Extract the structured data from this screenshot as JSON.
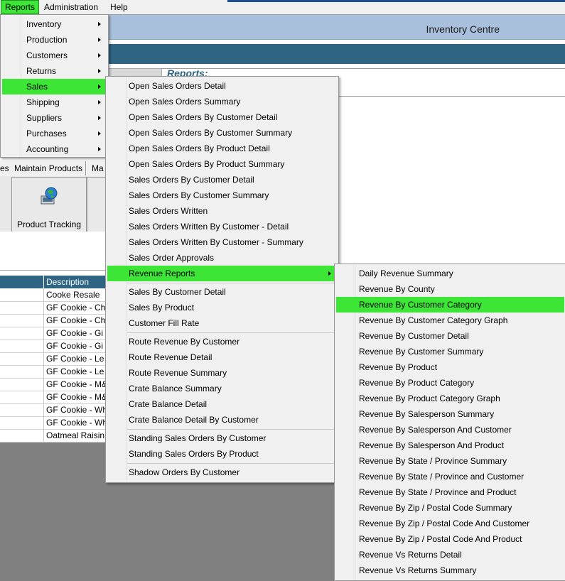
{
  "menubar": {
    "reports": "Reports",
    "administration": "Administration",
    "help": "Help"
  },
  "app": {
    "title": "Inventory Centre",
    "reports_heading": "Reports:",
    "tabs": [
      {
        "label": "es"
      },
      {
        "label": "Maintain Products"
      },
      {
        "label": "Ma"
      }
    ],
    "toolbar_button": {
      "label": "Product Tracking",
      "icon": "globe-computer-icon"
    }
  },
  "grid": {
    "header": "Description",
    "rows": [
      "Cooke Resale",
      "GF Cookie - Ch",
      "GF Cookie - Ch",
      "GF Cookie - Gi",
      "GF Cookie - Gi",
      "GF Cookie - Le",
      "GF Cookie - Le",
      "GF Cookie - M&",
      "GF Cookie - M&",
      "GF Cookie - Wh",
      "GF Cookie - Wh",
      "Oatmeal Raisin"
    ]
  },
  "reports_menu": {
    "items": [
      "Inventory",
      "Production",
      "Customers",
      "Returns",
      "Sales",
      "Shipping",
      "Suppliers",
      "Purchases",
      "Accounting"
    ],
    "highlighted": "Sales"
  },
  "sales_menu": {
    "items": [
      "Open Sales Orders Detail",
      "Open Sales Orders Summary",
      "Open Sales Orders By Customer Detail",
      "Open Sales Orders By Customer Summary",
      "Open Sales Orders By Product Detail",
      "Open Sales Orders By Product Summary",
      "Sales Orders By Customer Detail",
      "Sales Orders By Customer Summary",
      "Sales Orders Written",
      "Sales Orders Written By Customer - Detail",
      "Sales Orders Written By Customer - Summary",
      "Sales Order Approvals",
      "Revenue Reports",
      "Sales By Customer Detail",
      "Sales By Product",
      "Customer Fill Rate",
      "Route Revenue By Customer",
      "Route Revenue Detail",
      "Route Revenue Summary",
      "Crate Balance Summary",
      "Crate Balance Detail",
      "Crate Balance Detail By Customer",
      "Standing Sales Orders By Customer",
      "Standing Sales Orders By Product",
      "Shadow Orders By Customer"
    ],
    "highlighted": "Revenue Reports"
  },
  "revenue_menu": {
    "items": [
      "Daily Revenue Summary",
      "Revenue By County",
      "Revenue By Customer Category",
      "Revenue By Customer Category Graph",
      "Revenue By Customer Detail",
      "Revenue By Customer Summary",
      "Revenue By Product",
      "Revenue By Product Category",
      "Revenue By Product Category Graph",
      "Revenue By Salesperson Summary",
      "Revenue By Salesperson And Customer",
      "Revenue By Salesperson And Product",
      "Revenue By State / Province Summary",
      "Revenue By State / Province and Customer",
      "Revenue By State / Province and Product",
      "Revenue By Zip / Postal Code Summary",
      "Revenue By Zip / Postal Code And Customer",
      "Revenue By Zip / Postal Code And Product",
      "Revenue Vs Returns Detail",
      "Revenue Vs Returns Summary"
    ],
    "highlighted": "Revenue By Customer Category"
  },
  "colors": {
    "highlight": "#3de636",
    "band": "#2f6483",
    "title_bar": "#a8c0dc"
  }
}
